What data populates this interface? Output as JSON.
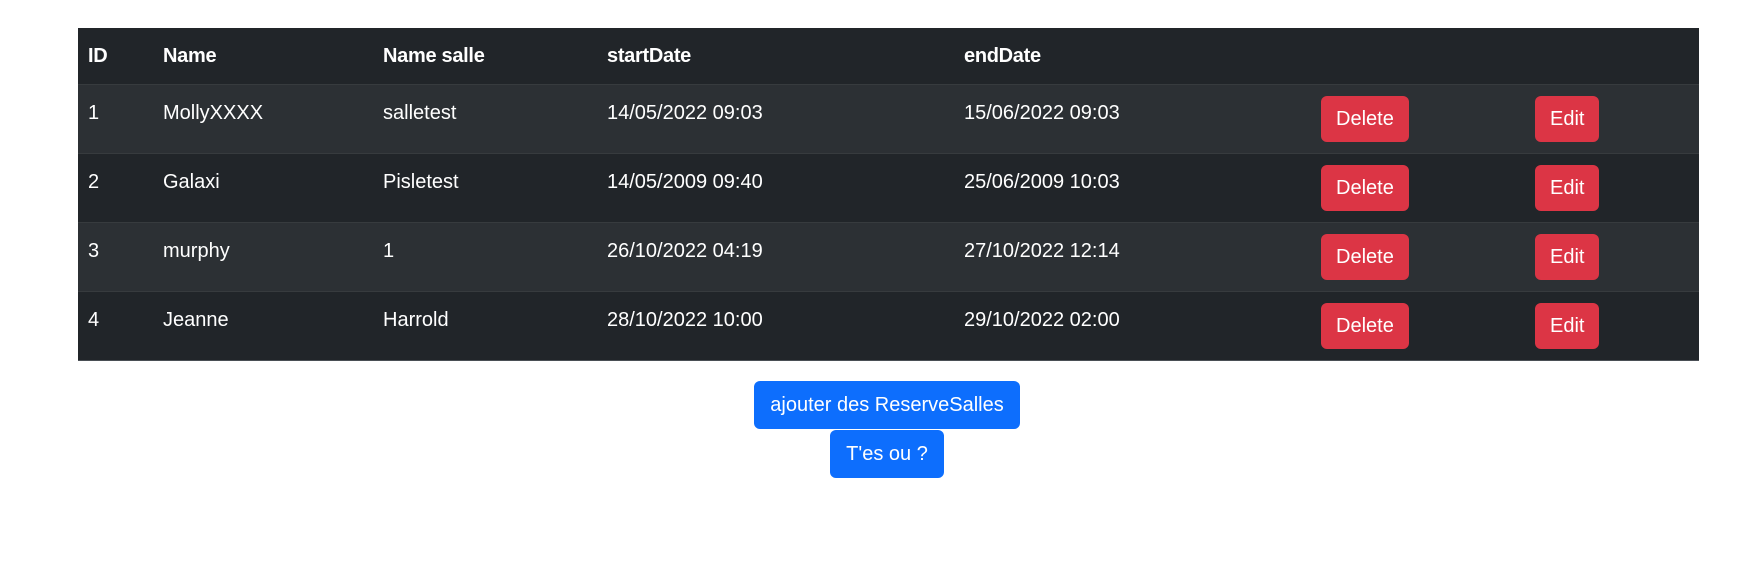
{
  "table": {
    "headers": {
      "id": "ID",
      "name": "Name",
      "name_salle": "Name salle",
      "start": "startDate",
      "end": "endDate"
    },
    "rows": [
      {
        "id": "1",
        "name": "MollyXXXX",
        "salle": "salletest",
        "start": "14/05/2022 09:03",
        "end": "15/06/2022 09:03",
        "delete_label": "Delete",
        "edit_label": "Edit"
      },
      {
        "id": "2",
        "name": "Galaxi",
        "salle": "Pisletest",
        "start": "14/05/2009 09:40",
        "end": "25/06/2009 10:03",
        "delete_label": "Delete",
        "edit_label": "Edit"
      },
      {
        "id": "3",
        "name": "murphy",
        "salle": "1",
        "start": "26/10/2022 04:19",
        "end": "27/10/2022 12:14",
        "delete_label": "Delete",
        "edit_label": "Edit"
      },
      {
        "id": "4",
        "name": "Jeanne",
        "salle": "Harrold",
        "start": "28/10/2022 10:00",
        "end": "29/10/2022 02:00",
        "delete_label": "Delete",
        "edit_label": "Edit"
      }
    ]
  },
  "actions": {
    "add_label": "ajouter des ReserveSalles",
    "where_label": "T'es ou ?"
  },
  "colors": {
    "table_bg": "#212529",
    "table_stripe": "#2c3034",
    "danger": "#dc3545",
    "primary": "#0d6efd"
  }
}
